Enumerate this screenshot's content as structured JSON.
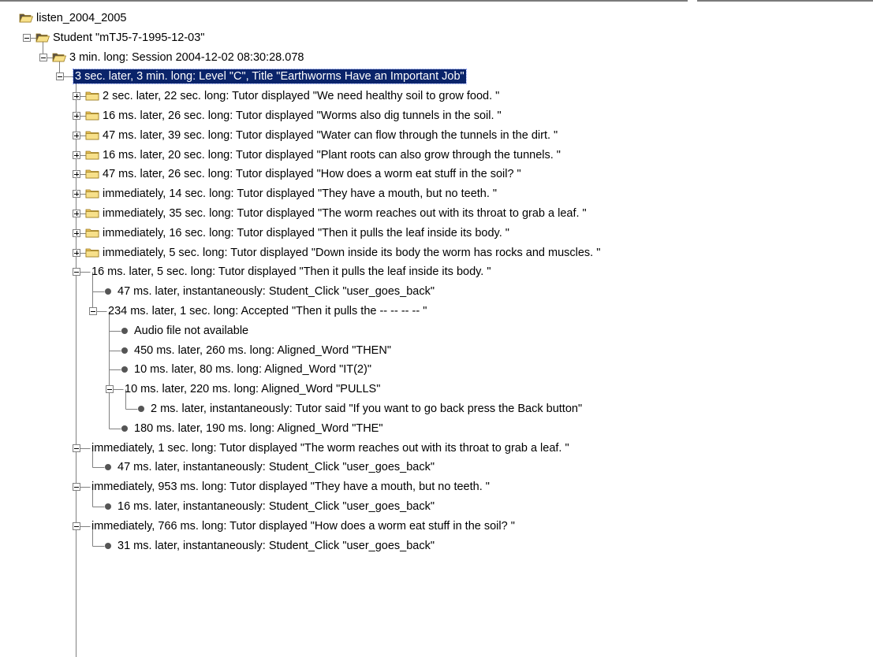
{
  "tree": [
    {
      "text": "listen_2004_2005",
      "depth": 0,
      "icon": "folder-open-icon",
      "toggle": "none"
    },
    {
      "text": "Student \"mTJ5-7-1995-12-03\"",
      "depth": 1,
      "icon": "folder-open-icon",
      "toggle": "collapse"
    },
    {
      "text": "3 min. long:  Session 2004-12-02 08:30:28.078",
      "depth": 2,
      "icon": "folder-open-icon",
      "toggle": "collapse"
    },
    {
      "text": "3 sec. later, 3 min. long:  Level \"C\", Title \"Earthworms Have an Important Job\"",
      "depth": 3,
      "icon": "none",
      "toggle": "collapse",
      "selected": true
    },
    {
      "text": "2 sec. later, 22 sec. long:  Tutor displayed \"We need healthy soil to grow food. \"",
      "depth": 4,
      "icon": "folder-closed-icon",
      "toggle": "expand"
    },
    {
      "text": "16 ms. later, 26 sec. long:  Tutor displayed \"Worms also dig tunnels in the soil. \"",
      "depth": 4,
      "icon": "folder-closed-icon",
      "toggle": "expand"
    },
    {
      "text": "47 ms. later, 39 sec. long:  Tutor displayed \"Water can flow through the tunnels in the dirt. \"",
      "depth": 4,
      "icon": "folder-closed-icon",
      "toggle": "expand"
    },
    {
      "text": "16 ms. later, 20 sec. long:  Tutor displayed \"Plant roots can also grow through the tunnels. \"",
      "depth": 4,
      "icon": "folder-closed-icon",
      "toggle": "expand"
    },
    {
      "text": "47 ms. later, 26 sec. long:  Tutor displayed \"How does a worm eat stuff in the soil? \"",
      "depth": 4,
      "icon": "folder-closed-icon",
      "toggle": "expand"
    },
    {
      "text": "immediately, 14 sec. long:  Tutor displayed \"They have a mouth, but no teeth. \"",
      "depth": 4,
      "icon": "folder-closed-icon",
      "toggle": "expand"
    },
    {
      "text": "immediately, 35 sec. long:  Tutor displayed \"The worm reaches out with its throat to grab a leaf. \"",
      "depth": 4,
      "icon": "folder-closed-icon",
      "toggle": "expand"
    },
    {
      "text": "immediately, 16 sec. long:  Tutor displayed \"Then it pulls the leaf inside its body. \"",
      "depth": 4,
      "icon": "folder-closed-icon",
      "toggle": "expand"
    },
    {
      "text": "immediately, 5 sec. long:  Tutor displayed \"Down inside its body the worm has rocks and muscles. \"",
      "depth": 4,
      "icon": "folder-closed-icon",
      "toggle": "expand"
    },
    {
      "text": "16 ms. later, 5 sec. long:  Tutor displayed \"Then it pulls the leaf inside its body. \"",
      "depth": 4,
      "icon": "none",
      "toggle": "collapse"
    },
    {
      "text": "47 ms. later, instantaneously:  Student_Click \"user_goes_back\"",
      "depth": 5,
      "icon": "leaf-node-icon",
      "toggle": "none"
    },
    {
      "text": "234 ms. later, 1 sec. long:  Accepted  \"Then it pulls the -- -- -- -- \"",
      "depth": 5,
      "icon": "none",
      "toggle": "collapse"
    },
    {
      "text": "Audio file not available",
      "depth": 6,
      "icon": "leaf-node-icon",
      "toggle": "none"
    },
    {
      "text": "450 ms. later, 260 ms. long:  Aligned_Word \"THEN\"",
      "depth": 6,
      "icon": "leaf-node-icon",
      "toggle": "none"
    },
    {
      "text": "10 ms. later, 80 ms. long:  Aligned_Word \"IT(2)\"",
      "depth": 6,
      "icon": "leaf-node-icon",
      "toggle": "none"
    },
    {
      "text": "10 ms. later, 220 ms. long:  Aligned_Word \"PULLS\"",
      "depth": 6,
      "icon": "none",
      "toggle": "collapse"
    },
    {
      "text": "2 ms. later, instantaneously:  Tutor said \"If you want to go back press the Back button\"",
      "depth": 7,
      "icon": "leaf-node-icon",
      "toggle": "none"
    },
    {
      "text": "180 ms. later, 190 ms. long:  Aligned_Word \"THE\"",
      "depth": 6,
      "icon": "leaf-node-icon",
      "toggle": "none"
    },
    {
      "text": "immediately, 1 sec. long:  Tutor displayed \"The worm reaches out with its throat to grab a leaf. \"",
      "depth": 4,
      "icon": "none",
      "toggle": "collapse"
    },
    {
      "text": "47 ms. later, instantaneously:  Student_Click \"user_goes_back\"",
      "depth": 5,
      "icon": "leaf-node-icon",
      "toggle": "none"
    },
    {
      "text": "immediately, 953 ms. long:  Tutor displayed \"They have a mouth, but no teeth. \"",
      "depth": 4,
      "icon": "none",
      "toggle": "collapse"
    },
    {
      "text": "16 ms. later, instantaneously:  Student_Click \"user_goes_back\"",
      "depth": 5,
      "icon": "leaf-node-icon",
      "toggle": "none"
    },
    {
      "text": "immediately, 766 ms. long:  Tutor displayed \"How does a worm eat stuff in the soil? \"",
      "depth": 4,
      "icon": "none",
      "toggle": "collapse"
    },
    {
      "text": "31 ms. later, instantaneously:  Student_Click \"user_goes_back\"",
      "depth": 5,
      "icon": "leaf-node-icon",
      "toggle": "none"
    }
  ],
  "colors": {
    "selection_bg": "#0a246a",
    "selection_text": "#ffffff",
    "folder_fill": "#f7e08a",
    "folder_tab": "#e9c25a",
    "folder_outline": "#9a7a1c",
    "folder_open_dark": "#58504a",
    "tree_line": "#808080",
    "leaf_dot": "#555555"
  }
}
